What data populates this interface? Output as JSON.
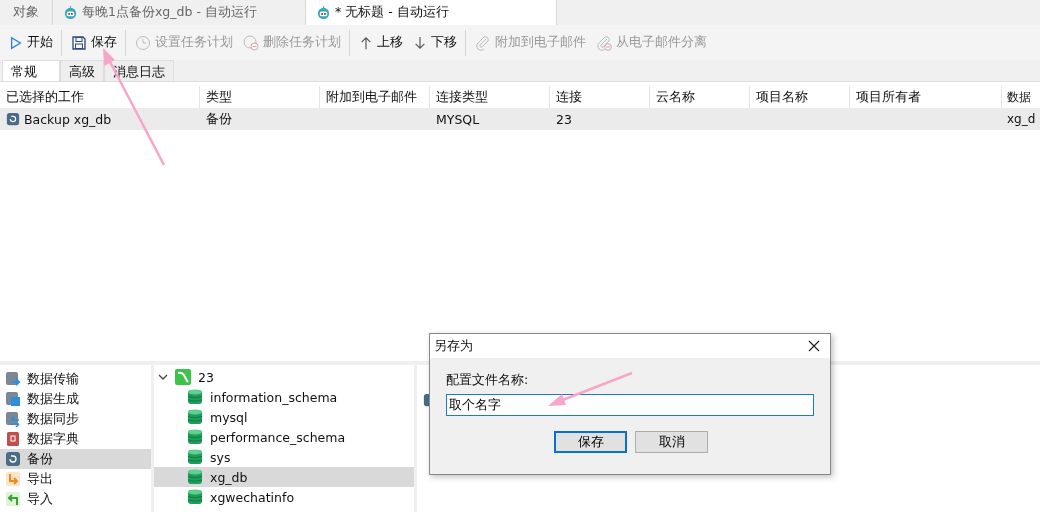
{
  "doc_tabs": [
    {
      "label": "对象",
      "icon": false,
      "selected": false
    },
    {
      "label": "每晚1点备份xg_db - 自动运行",
      "icon": true,
      "selected": false
    },
    {
      "label": "* 无标题 - 自动运行",
      "icon": true,
      "selected": true
    }
  ],
  "toolbar": [
    {
      "kind": "play",
      "label": "开始",
      "disabled": false,
      "sep_after": true
    },
    {
      "kind": "save",
      "label": "保存",
      "disabled": false,
      "sep_after": true
    },
    {
      "kind": "clock",
      "label": "设置任务计划",
      "disabled": true,
      "sep_after": false
    },
    {
      "kind": "remove",
      "label": "删除任务计划",
      "disabled": true,
      "sep_after": true
    },
    {
      "kind": "up",
      "label": "上移",
      "disabled": false,
      "sep_after": false
    },
    {
      "kind": "down",
      "label": "下移",
      "disabled": false,
      "sep_after": true
    },
    {
      "kind": "clip",
      "label": "附加到电子邮件",
      "disabled": true,
      "sep_after": false
    },
    {
      "kind": "unclip",
      "label": "从电子邮件分离",
      "disabled": true,
      "sep_after": false
    }
  ],
  "sub_tabs": [
    {
      "label": "常规",
      "selected": true
    },
    {
      "label": "高级",
      "selected": false
    },
    {
      "label": "消息日志",
      "selected": false
    }
  ],
  "table": {
    "columns": [
      "已选择的工作",
      "类型",
      "附加到电子邮件",
      "连接类型",
      "连接",
      "云名称",
      "项目名称",
      "项目所有者",
      "数据"
    ],
    "rows": [
      {
        "selected": true,
        "cells": [
          "Backup xg_db",
          "备份",
          "",
          "MYSQL",
          "23",
          "",
          "",
          "",
          "xg_d"
        ]
      }
    ]
  },
  "job_types": [
    {
      "kind": "transfer",
      "label": "数据传输",
      "selected": false
    },
    {
      "kind": "generate",
      "label": "数据生成",
      "selected": false
    },
    {
      "kind": "sync",
      "label": "数据同步",
      "selected": false
    },
    {
      "kind": "dict",
      "label": "数据字典",
      "selected": false
    },
    {
      "kind": "backup",
      "label": "备份",
      "selected": true
    },
    {
      "kind": "export",
      "label": "导出",
      "selected": false
    },
    {
      "kind": "import",
      "label": "导入",
      "selected": false
    }
  ],
  "tree": {
    "label": "23",
    "expanded": true,
    "children": [
      {
        "label": "information_schema",
        "selected": false
      },
      {
        "label": "mysql",
        "selected": false
      },
      {
        "label": "performance_schema",
        "selected": false
      },
      {
        "label": "sys",
        "selected": false
      },
      {
        "label": "xg_db",
        "selected": true
      },
      {
        "label": "xgwechatinfo",
        "selected": false
      }
    ]
  },
  "dialog": {
    "title": "另存为",
    "field_label": "配置文件名称:",
    "field_value": "取个名字",
    "buttons": [
      {
        "label": "保存",
        "default": true
      },
      {
        "label": "取消",
        "default": false
      }
    ]
  }
}
